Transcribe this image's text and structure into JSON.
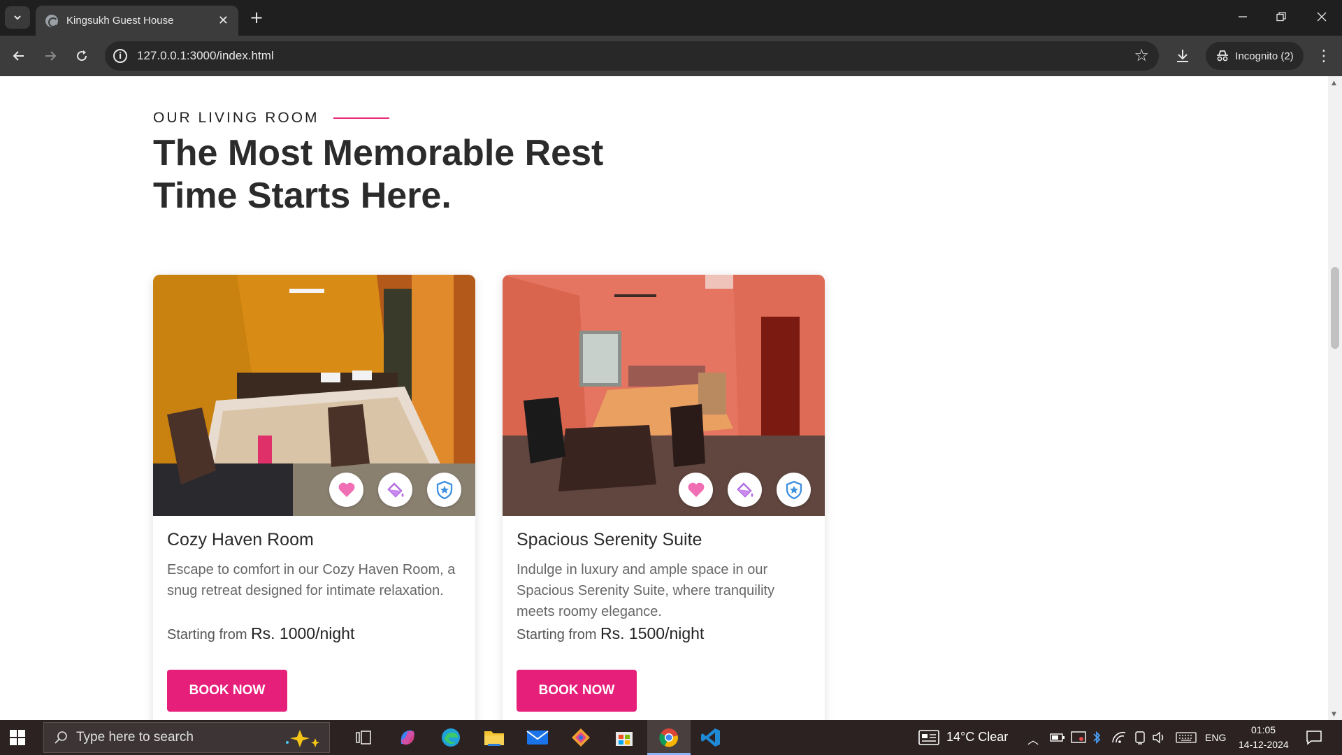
{
  "browser": {
    "tab_title": "Kingsukh Guest House",
    "url": "127.0.0.1:3000/index.html",
    "incognito_label": "Incognito (2)"
  },
  "page": {
    "eyebrow": "OUR LIVING ROOM",
    "headline_line1": "The Most Memorable Rest",
    "headline_line2": "Time Starts Here.",
    "accent_color": "#e6207a",
    "rooms": [
      {
        "title": "Cozy Haven Room",
        "description": "Escape to comfort in our Cozy Haven Room, a snug retreat designed for intimate relaxation.",
        "price_prefix": "Starting from",
        "price": "Rs. 1000/night",
        "button_label": "BOOK NOW",
        "icons": [
          "heart-icon",
          "paint-bucket-icon",
          "shield-star-icon"
        ]
      },
      {
        "title": "Spacious Serenity Suite",
        "description": "Indulge in luxury and ample space in our Spacious Serenity Suite, where tranquility meets roomy elegance.",
        "price_prefix": "Starting from",
        "price": "Rs. 1500/night",
        "button_label": "BOOK NOW",
        "icons": [
          "heart-icon",
          "paint-bucket-icon",
          "shield-star-icon"
        ]
      }
    ]
  },
  "taskbar": {
    "search_placeholder": "Type here to search",
    "weather": "14°C  Clear",
    "language": "ENG",
    "time": "01:05",
    "date": "14-12-2024"
  }
}
